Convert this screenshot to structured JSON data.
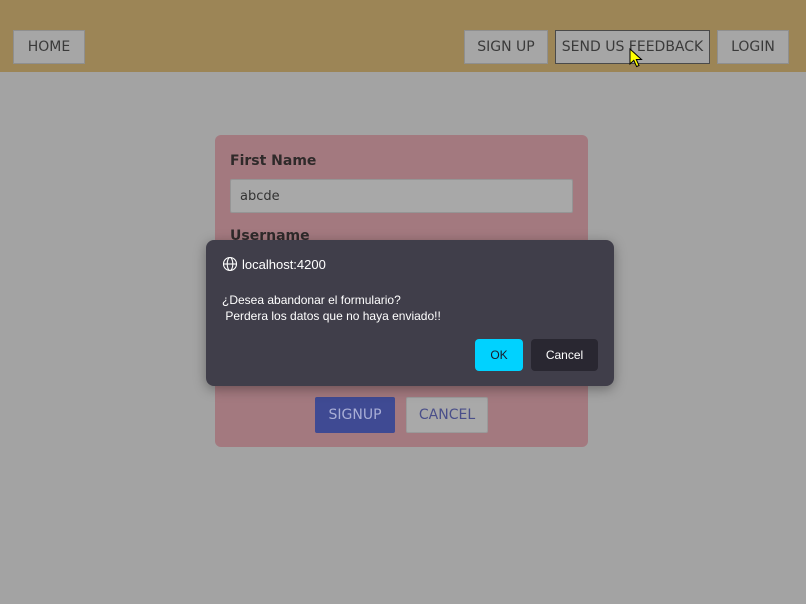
{
  "navbar": {
    "home_label": "HOME",
    "signup_label": "SIGN UP",
    "feedback_label": "SEND US FEEDBACK",
    "login_label": "LOGIN"
  },
  "form": {
    "first_name_label": "First Name",
    "first_name_value": "abcde",
    "username_label": "Username",
    "signup_button": "SIGNUP",
    "cancel_button": "CANCEL"
  },
  "dialog": {
    "origin": "localhost:4200",
    "message_line1": "¿Desea abandonar el formulario?",
    "message_line2": " Perdera los datos que no haya enviado!!",
    "ok_label": "OK",
    "cancel_label": "Cancel"
  },
  "colors": {
    "navbar": "#9c8556",
    "card": "#a3797f",
    "dialog": "#403e4a",
    "ok_button": "#00d2ff",
    "signup_button": "#3f4a93"
  },
  "icons": {
    "origin": "globe-icon",
    "pointer": "mouse-cursor-icon"
  }
}
